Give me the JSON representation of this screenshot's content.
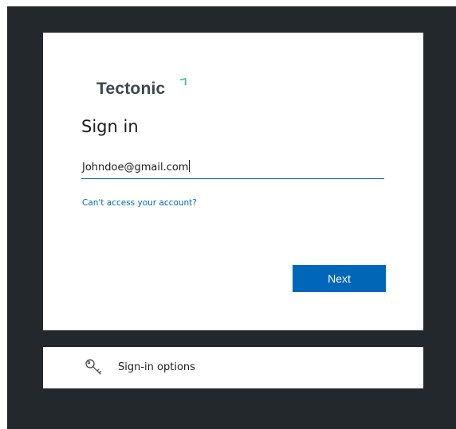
{
  "brand": {
    "name": "Tectonic",
    "text_color": "#3a4750",
    "accent_color": "#2bb5a0"
  },
  "signin": {
    "title": "Sign in",
    "email_value": "Johndoe@gmail.com",
    "cant_access_link": "Can't access your account?",
    "next_label": "Next"
  },
  "options": {
    "label": "Sign-in options",
    "icon": "key-icon"
  },
  "colors": {
    "primary": "#0067b8",
    "backdrop": "#23282c"
  }
}
